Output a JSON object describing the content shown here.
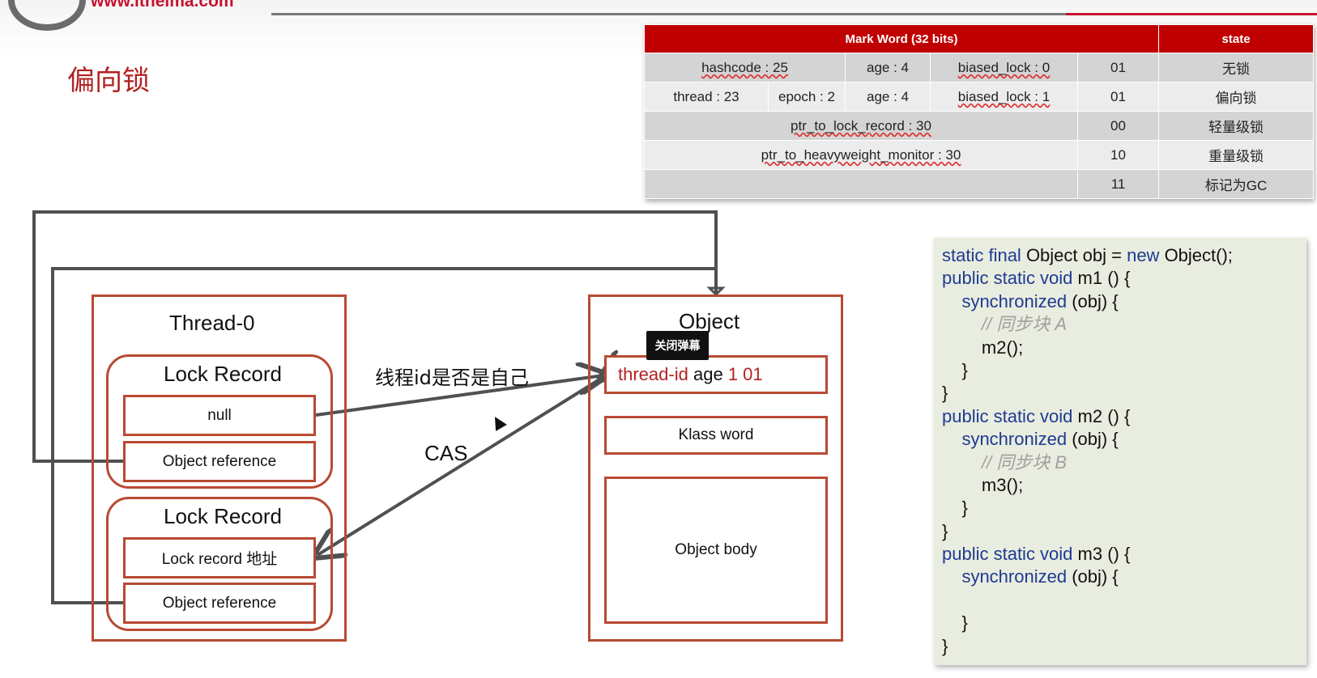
{
  "header": {
    "logo_url": "www.itheima.com",
    "title": "偏向锁"
  },
  "mark_word": {
    "header": {
      "markword": "Mark Word (32 bits)",
      "state": "state"
    },
    "rows": [
      {
        "cells": [
          "hashcode : 25",
          "age : 4",
          "biased_lock : 0"
        ],
        "bits": "01",
        "state": "无锁"
      },
      {
        "cells": [
          "thread : 23",
          "epoch : 2",
          "age : 4",
          "biased_lock : 1"
        ],
        "bits": "01",
        "state": "偏向锁"
      },
      {
        "cells": [
          "ptr_to_lock_record : 30"
        ],
        "bits": "00",
        "state": "轻量级锁"
      },
      {
        "cells": [
          "ptr_to_heavyweight_monitor : 30"
        ],
        "bits": "10",
        "state": "重量级锁"
      },
      {
        "cells": [
          ""
        ],
        "bits": "11",
        "state": "标记为GC"
      }
    ]
  },
  "diagram": {
    "thread_title": "Thread-0",
    "lock_record_1": {
      "title": "Lock Record",
      "field1": "null",
      "field2": "Object reference"
    },
    "lock_record_2": {
      "title": "Lock Record",
      "field1": "Lock record 地址",
      "field2": "Object reference"
    },
    "object_title": "Object",
    "mark_thread": "thread-id",
    "mark_age": "age",
    "mark_bits": "1 01",
    "klass_word": "Klass word",
    "object_body": "Object body",
    "arrow_label_top": "线程id是否是自己",
    "arrow_label_cas": "CAS",
    "tooltip": "关闭弹幕"
  },
  "code": [
    [
      {
        "t": "static final ",
        "c": "kw"
      },
      {
        "t": "Object obj = ",
        "c": ""
      },
      {
        "t": "new ",
        "c": "kw"
      },
      {
        "t": "Object();",
        "c": ""
      }
    ],
    [
      {
        "t": "public static void ",
        "c": "kw"
      },
      {
        "t": "m1 () {",
        "c": ""
      }
    ],
    [
      {
        "t": "    synchronized ",
        "c": "kw"
      },
      {
        "t": "(obj) {",
        "c": ""
      }
    ],
    [
      {
        "t": "        // 同步块 A",
        "c": "cm"
      }
    ],
    [
      {
        "t": "        m2();",
        "c": ""
      }
    ],
    [
      {
        "t": "    }",
        "c": ""
      }
    ],
    [
      {
        "t": "}",
        "c": ""
      }
    ],
    [
      {
        "t": "public static void ",
        "c": "kw"
      },
      {
        "t": "m2 () {",
        "c": ""
      }
    ],
    [
      {
        "t": "    synchronized ",
        "c": "kw"
      },
      {
        "t": "(obj) {",
        "c": ""
      }
    ],
    [
      {
        "t": "        // 同步块 B",
        "c": "cm"
      }
    ],
    [
      {
        "t": "        m3();",
        "c": ""
      }
    ],
    [
      {
        "t": "    }",
        "c": ""
      }
    ],
    [
      {
        "t": "}",
        "c": ""
      }
    ],
    [
      {
        "t": "public static void ",
        "c": "kw"
      },
      {
        "t": "m3 () {",
        "c": ""
      }
    ],
    [
      {
        "t": "    synchronized ",
        "c": "kw"
      },
      {
        "t": "(obj) {",
        "c": ""
      }
    ],
    [
      {
        "t": "",
        "c": ""
      }
    ],
    [
      {
        "t": "    }",
        "c": ""
      }
    ],
    [
      {
        "t": "}",
        "c": ""
      }
    ]
  ],
  "colors": {
    "accent_red": "#c00000",
    "border_red": "#b84a33",
    "keyword_blue": "#1f3a93",
    "code_bg": "#e8eddf"
  }
}
